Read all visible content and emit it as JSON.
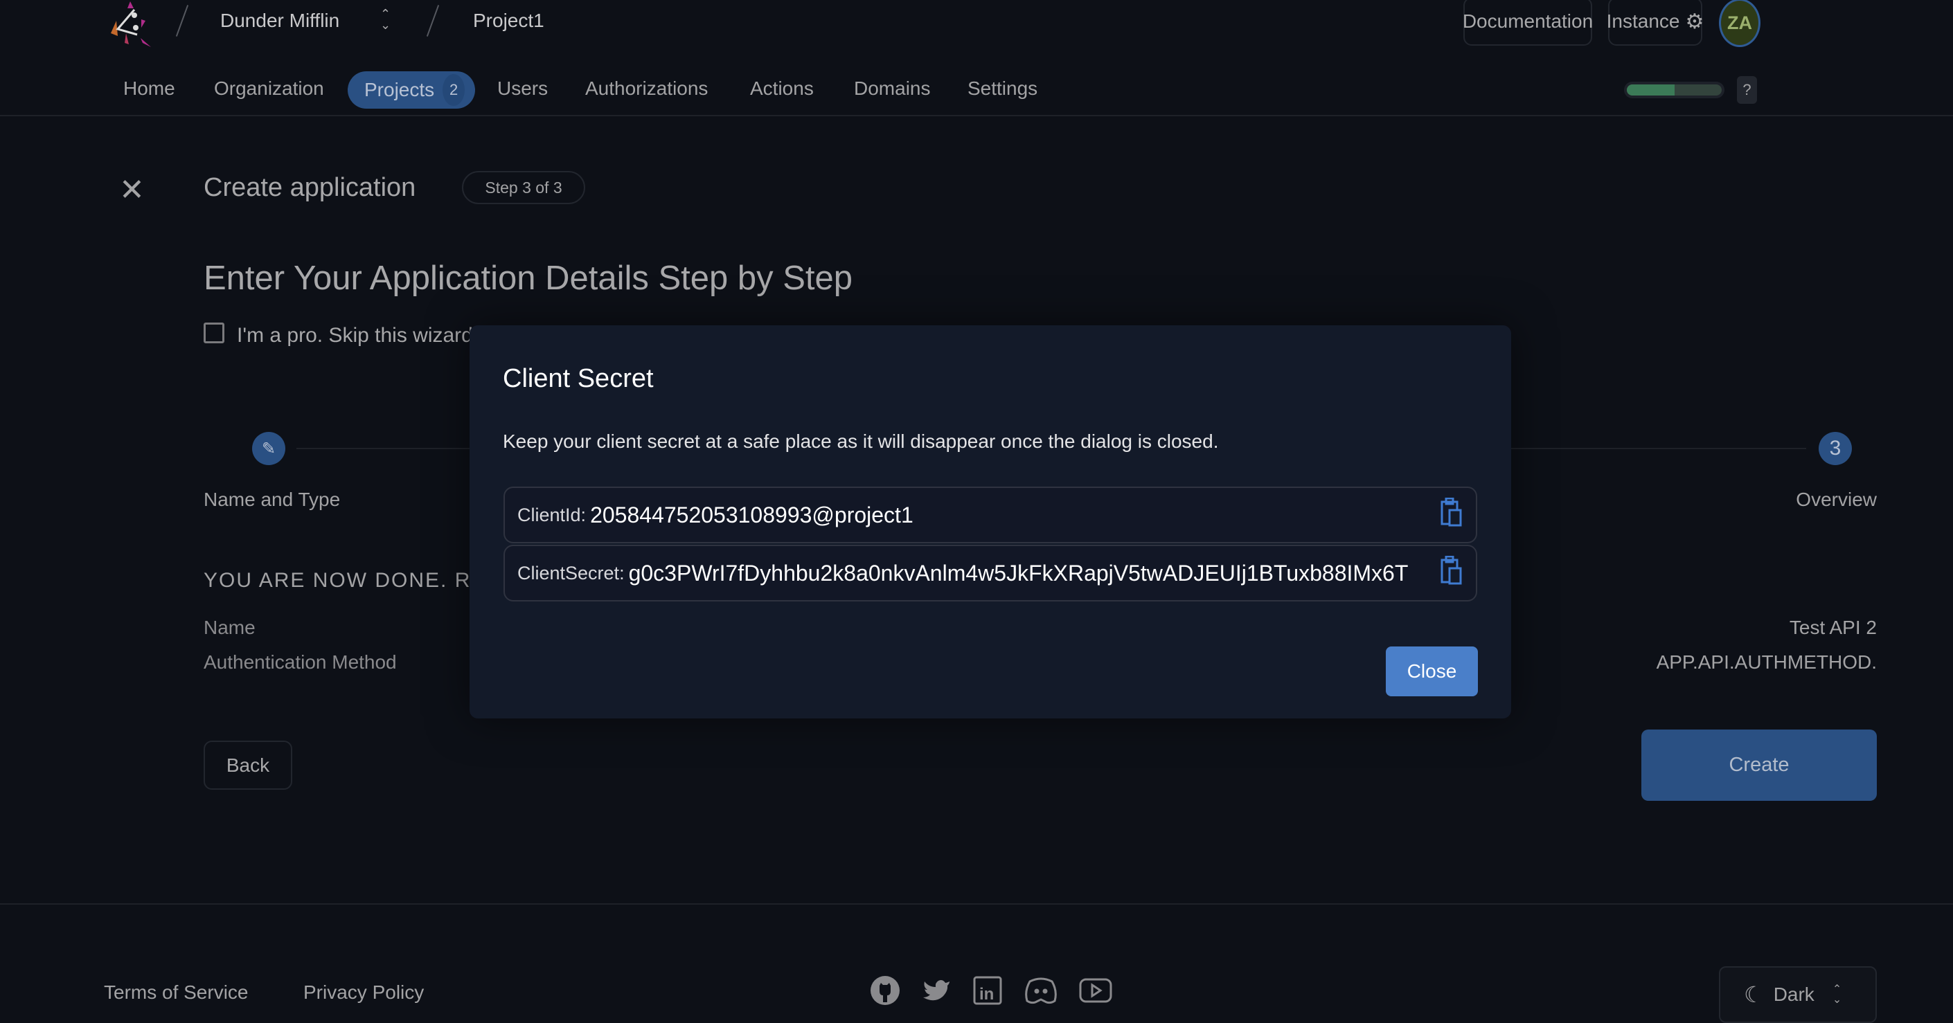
{
  "header": {
    "org": "Dunder Mifflin",
    "project": "Project1",
    "documentation": "Documentation",
    "instance": "Instance",
    "avatar": "ZA",
    "help": "?",
    "progress_percent": 50
  },
  "nav": {
    "items": [
      {
        "label": "Home"
      },
      {
        "label": "Organization"
      },
      {
        "label": "Projects",
        "badge": "2",
        "active": true
      },
      {
        "label": "Users"
      },
      {
        "label": "Authorizations"
      },
      {
        "label": "Actions"
      },
      {
        "label": "Domains"
      },
      {
        "label": "Settings"
      }
    ]
  },
  "page": {
    "title": "Create application",
    "step_badge": "Step 3 of 3",
    "heading": "Enter Your Application Details Step by Step",
    "skip_label": "I'm a pro. Skip this wizard",
    "steps": [
      {
        "label": "Name and Type",
        "icon": "pencil-icon"
      },
      {
        "label": "Overview",
        "number": "3"
      }
    ],
    "done_text": "YOU ARE NOW DONE. R",
    "summary": [
      {
        "key": "Name",
        "value": "Test API 2"
      },
      {
        "key": "Authentication Method",
        "value": "APP.API.AUTHMETHOD."
      }
    ],
    "back": "Back",
    "create": "Create"
  },
  "dialog": {
    "title": "Client Secret",
    "description": "Keep your client secret at a safe place as it will disappear once the dialog is closed.",
    "client_id_label": "ClientId:",
    "client_id": "205844752053108993@project1",
    "client_secret_label": "ClientSecret:",
    "client_secret": "g0c3PWrI7fDyhhbu2k8a0nkvAnlm4w5JkFkXRapjV5twADJEUIj1BTuxb88IMx6T",
    "close": "Close"
  },
  "footer": {
    "terms": "Terms of Service",
    "privacy": "Privacy Policy",
    "social": [
      "github-icon",
      "twitter-icon",
      "linkedin-icon",
      "discord-icon",
      "youtube-icon"
    ],
    "theme": "Dark"
  },
  "colors": {
    "accent": "#2a5083",
    "dialog_button": "#4a7fc9",
    "progress": "#3b7a57",
    "avatar_bg": "#2d3a17"
  }
}
